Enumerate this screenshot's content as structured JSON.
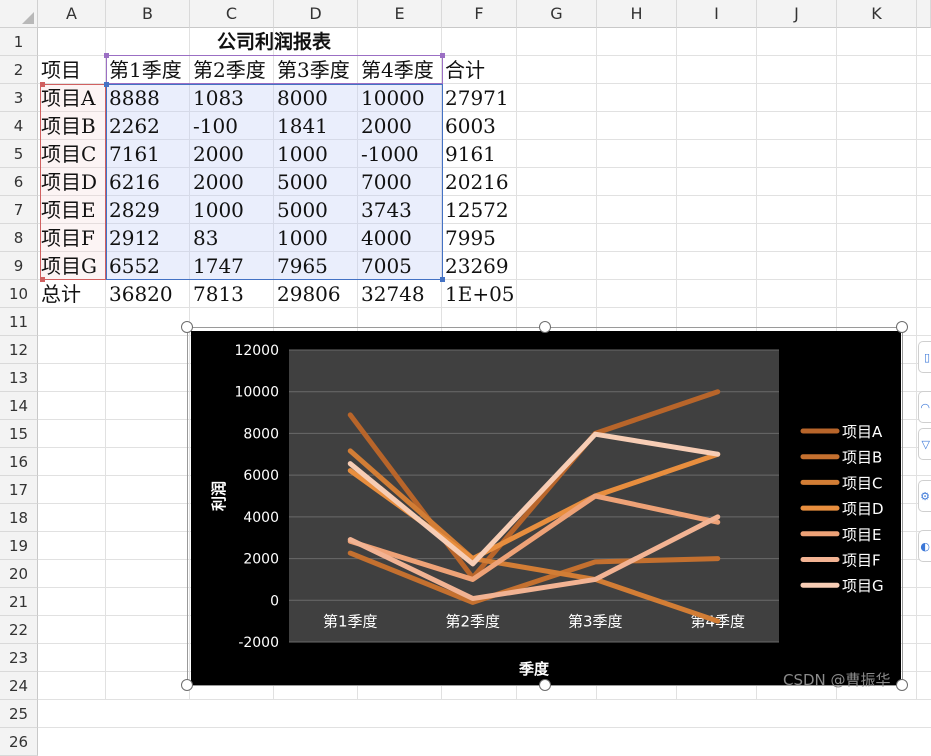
{
  "spreadsheet": {
    "columns": [
      "A",
      "B",
      "C",
      "D",
      "E",
      "F",
      "G",
      "H",
      "I",
      "J",
      "K"
    ],
    "rows": [
      "1",
      "2",
      "3",
      "4",
      "5",
      "6",
      "7",
      "8",
      "9",
      "10",
      "11",
      "12",
      "13",
      "14",
      "15",
      "16",
      "17",
      "18",
      "19",
      "20",
      "21",
      "22",
      "23",
      "24",
      "25",
      "26"
    ],
    "title": "公司利润报表",
    "header_row": [
      "项目",
      "第1季度",
      "第2季度",
      "第3季度",
      "第4季度",
      "合计"
    ],
    "data_rows": [
      [
        "项目A",
        "8888",
        "1083",
        "8000",
        "10000",
        "27971"
      ],
      [
        "项目B",
        "2262",
        "-100",
        "1841",
        "2000",
        "6003"
      ],
      [
        "项目C",
        "7161",
        "2000",
        "1000",
        "-1000",
        "9161"
      ],
      [
        "项目D",
        "6216",
        "2000",
        "5000",
        "7000",
        "20216"
      ],
      [
        "项目E",
        "2829",
        "1000",
        "5000",
        "3743",
        "12572"
      ],
      [
        "项目F",
        "2912",
        "83",
        "1000",
        "4000",
        "7995"
      ],
      [
        "项目G",
        "6552",
        "1747",
        "7965",
        "7005",
        "23269"
      ]
    ],
    "total_row": [
      "总计",
      "36820",
      "7813",
      "29806",
      "32748",
      "1E+05"
    ]
  },
  "chart_data": {
    "type": "line",
    "categories": [
      "第1季度",
      "第2季度",
      "第3季度",
      "第4季度"
    ],
    "series": [
      {
        "name": "项目A",
        "values": [
          8888,
          1083,
          8000,
          10000
        ],
        "color": "#b8652a"
      },
      {
        "name": "项目B",
        "values": [
          2262,
          -100,
          1841,
          2000
        ],
        "color": "#c4702f"
      },
      {
        "name": "项目C",
        "values": [
          7161,
          2000,
          1000,
          -1000
        ],
        "color": "#d27d35"
      },
      {
        "name": "项目D",
        "values": [
          6216,
          2000,
          5000,
          7000
        ],
        "color": "#e88e3e"
      },
      {
        "name": "项目E",
        "values": [
          2829,
          1000,
          5000,
          3743
        ],
        "color": "#eea277"
      },
      {
        "name": "项目F",
        "values": [
          2912,
          83,
          1000,
          4000
        ],
        "color": "#f2b393"
      },
      {
        "name": "项目G",
        "values": [
          6552,
          1747,
          7965,
          7005
        ],
        "color": "#f7cdb5"
      }
    ],
    "xlabel": "季度",
    "ylabel": "利润",
    "ylim": [
      -2000,
      12000
    ],
    "yticks": [
      "12000",
      "10000",
      "8000",
      "6000",
      "4000",
      "2000",
      "0",
      "-2000"
    ],
    "grid": true,
    "legend_position": "right",
    "background": "#000000",
    "plot_background": "#404040"
  },
  "side_toolbar": [
    "chart-elements-icon",
    "chart-styles-icon",
    "chart-filters-icon",
    "chart-settings-icon",
    "chart-format-icon"
  ],
  "watermark": "CSDN @曹振华"
}
